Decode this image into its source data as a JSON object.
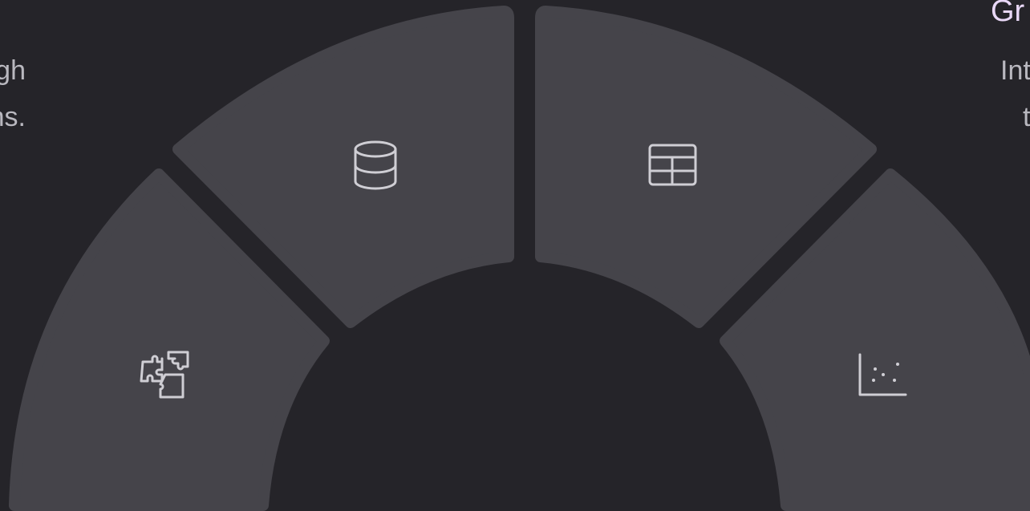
{
  "left_panel": {
    "line_1": "gh",
    "line_2": "ns."
  },
  "right_panel": {
    "title": "Gr",
    "line_1": "Int",
    "line_2": "t"
  },
  "ring": {
    "segment_color": "#45444a",
    "background_color": "#252429",
    "icon_color": "#cfced4",
    "title_color": "#e9d8f7",
    "segments": [
      {
        "icon": "puzzle-icon"
      },
      {
        "icon": "database-icon"
      },
      {
        "icon": "table-icon"
      },
      {
        "icon": "scatter-chart-icon"
      }
    ]
  }
}
